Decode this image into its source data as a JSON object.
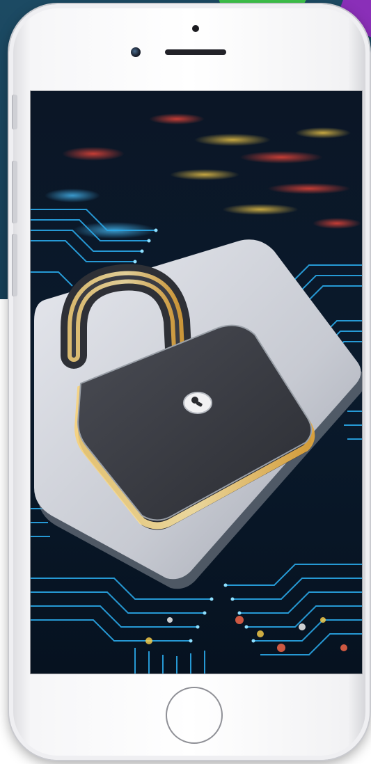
{
  "colors": {
    "background_panel": "#1c4a63",
    "accent_green": "#3ec24a",
    "accent_purple": "#8a2fb8",
    "phone_body": "#f4f4f6",
    "circuit_blue": "#2aa8e8",
    "lock_body": "#3b3d44",
    "lock_glow": "#f5c04a",
    "pad_base": "#c9ccd3"
  },
  "icons": {
    "lock": "padlock-icon",
    "keyhole": "keyhole-icon",
    "home": "home-button"
  }
}
